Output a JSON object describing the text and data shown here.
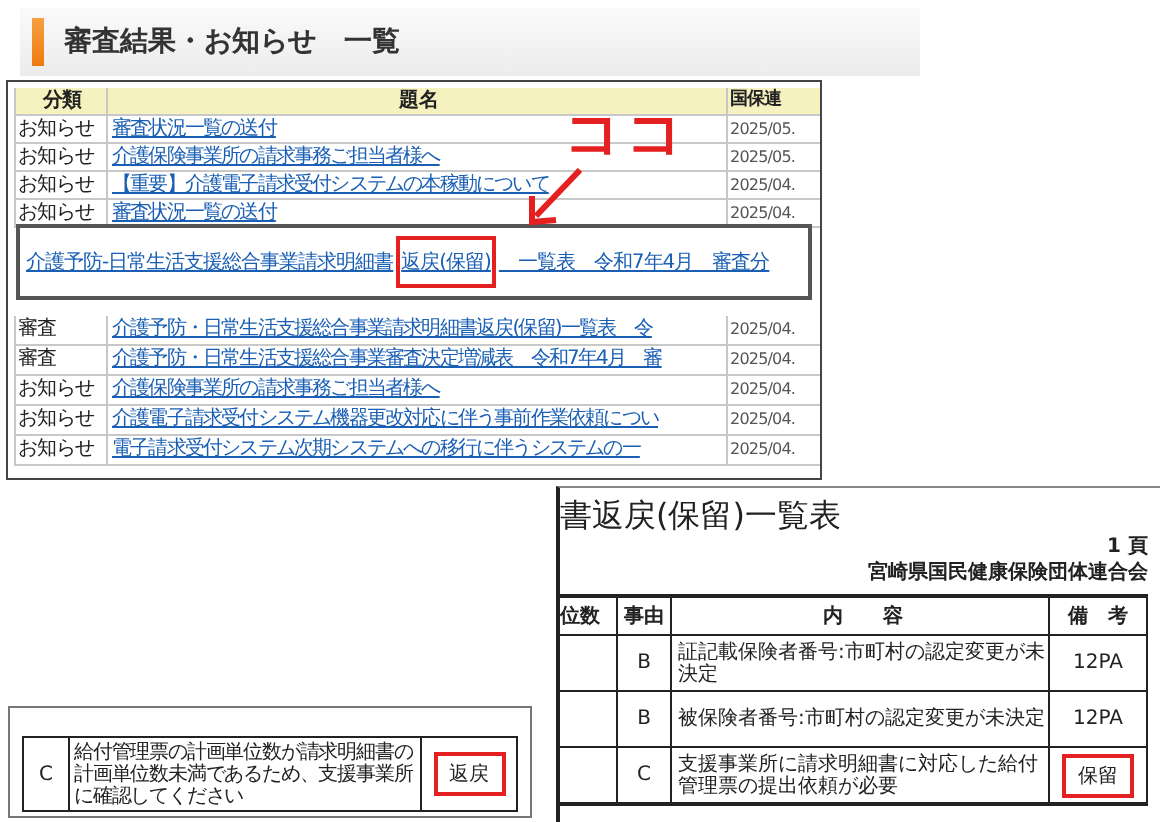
{
  "page_header": {
    "title": "審査結果・お知らせ　一覧"
  },
  "notice_table": {
    "columns": [
      "分類",
      "題名",
      "国保連"
    ],
    "top_rows": [
      {
        "category": "お知らせ",
        "title": "審査状況一覧の送付",
        "date": "2025/05."
      },
      {
        "category": "お知らせ",
        "title": "介護保険事業所の請求事務ご担当者様へ",
        "date": "2025/05."
      },
      {
        "category": "お知らせ",
        "title": "【重要】介護電子請求受付システムの本稼動について",
        "date": "2025/04."
      },
      {
        "category": "お知らせ",
        "title": "審査状況一覧の送付",
        "date": "2025/04."
      }
    ],
    "bottom_rows": [
      {
        "category": "審査",
        "title": "介護予防・日常生活支援総合事業請求明細書返戻(保留)一覧表　令",
        "date": "2025/04."
      },
      {
        "category": "審査",
        "title": "介護予防・日常生活支援総合事業審査決定増減表　令和7年4月　審",
        "date": "2025/04."
      },
      {
        "category": "お知らせ",
        "title": "介護保険事業所の請求事務ご担当者様へ",
        "date": "2025/04."
      },
      {
        "category": "お知らせ",
        "title": "介護電子請求受付システム機器更改対応に伴う事前作業依頼につい",
        "date": "2025/04."
      },
      {
        "category": "お知らせ",
        "title": "電子請求受付システム次期システムへの移行に伴うシステムの一",
        "date": "2025/04."
      }
    ]
  },
  "annotation": {
    "label": "ココ"
  },
  "zoom_callout": {
    "link_start": "介護予防‐日常生活支援総合事業請求明細書",
    "link_highlight": "返戻(保留)",
    "link_end": "　一覧表　令和7年4月　審査分"
  },
  "report": {
    "title": "書返戻(保留)一覧表",
    "page": "1 頁",
    "issuer": "宮崎県国民健康保険団体連合会",
    "columns": [
      "位数",
      "事由",
      "内　　容",
      "備　考"
    ],
    "rows": [
      {
        "code": "B",
        "content": "証記載保険者番号:市町村の認定変更が未決定",
        "remark": "12PA",
        "highlighted": false
      },
      {
        "code": "B",
        "content": "被保険者番号:市町村の認定変更が未決定",
        "remark": "12PA",
        "highlighted": false
      },
      {
        "code": "C",
        "content": "支援事業所に請求明細書に対応した給付管理票の提出依頼が必要",
        "remark": "保留",
        "highlighted": true
      }
    ]
  },
  "report_excerpt": {
    "rows": [
      {
        "code": "C",
        "content": "給付管理票の計画単位数が請求明細書の計画単位数未満であるため、支援事業所に確認してください",
        "remark": "返戻",
        "highlighted": true
      }
    ]
  }
}
